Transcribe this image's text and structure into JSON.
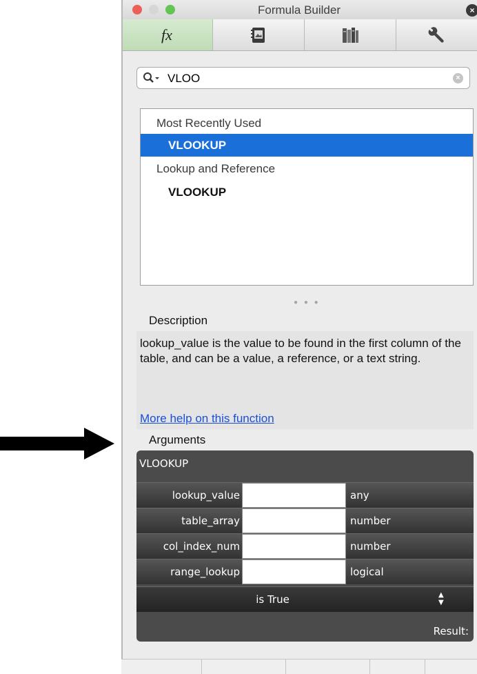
{
  "window": {
    "title": "Formula Builder",
    "traffic_lights": [
      "#ec5f58",
      "#d6d6d6",
      "#62c554"
    ]
  },
  "tabs": [
    {
      "name": "tab-functions",
      "label": "fx",
      "icon": "fx-icon",
      "active": true
    },
    {
      "name": "tab-media",
      "icon": "media-browser-icon",
      "active": false
    },
    {
      "name": "tab-library",
      "icon": "library-icon",
      "active": false
    },
    {
      "name": "tab-tools",
      "icon": "wrench-icon",
      "active": false
    }
  ],
  "search": {
    "value": "VLOO",
    "icon": "search-icon"
  },
  "function_list": [
    {
      "kind": "header",
      "label": "Most Recently Used"
    },
    {
      "kind": "item",
      "label": "VLOOKUP",
      "selected": true
    },
    {
      "kind": "header",
      "label": "Lookup and Reference"
    },
    {
      "kind": "item",
      "label": "VLOOKUP",
      "selected": false
    }
  ],
  "description": {
    "label": "Description",
    "text": "lookup_value is the value to be found in the first column of the table, and can be a value, a reference, or a text string.",
    "help_link": "More help on this function"
  },
  "arguments": {
    "label": "Arguments",
    "function_name": "VLOOKUP",
    "rows": [
      {
        "name": "lookup_value",
        "value": "",
        "type": "any"
      },
      {
        "name": "table_array",
        "value": "",
        "type": "number"
      },
      {
        "name": "col_index_num",
        "value": "",
        "type": "number"
      },
      {
        "name": "range_lookup",
        "value": "",
        "type": "logical"
      }
    ],
    "range_lookup_option": "is True",
    "result_label": "Result:"
  },
  "colors": {
    "selection": "#1a6fd9",
    "link": "#1a4fd6",
    "active_tab": "#c7e3bf",
    "arguments_panel": "#4b4b4b"
  }
}
